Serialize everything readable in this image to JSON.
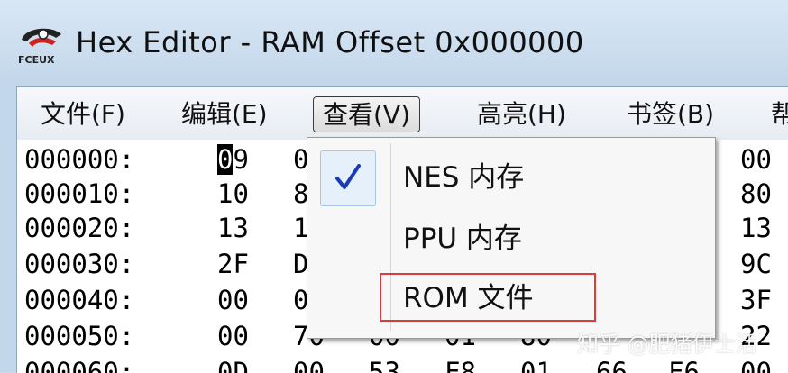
{
  "window": {
    "title": "Hex Editor - RAM Offset 0x000000",
    "logo_text": "FCEUX"
  },
  "menubar": {
    "items": [
      "文件(F)",
      "编辑(E)",
      "查看(V)",
      "高亮(H)",
      "书签(B)",
      "帮"
    ],
    "active": "查看(V)"
  },
  "hex": {
    "rows": [
      {
        "addr": "000000:",
        "b0": "09",
        "b1": "0",
        "rb": "00"
      },
      {
        "addr": "000010:",
        "b0": "10",
        "b1": "8",
        "rb": "80"
      },
      {
        "addr": "000020:",
        "b0": "13",
        "b1": "1",
        "rb": "13"
      },
      {
        "addr": "000030:",
        "b0": "2F",
        "b1": "D",
        "rb": "9C"
      },
      {
        "addr": "000040:",
        "b0": "00",
        "b1": "0",
        "rb": "3F"
      },
      {
        "addr": "000050:",
        "b0": "00",
        "b1": "70",
        "b2": "00",
        "b3": "01",
        "b4": "80",
        "rb": "22"
      },
      {
        "addr": "000060:",
        "b0": "0D",
        "b1": "00",
        "b2": "53",
        "b3": "F8",
        "b4": "01",
        "b5": "66",
        "b6": "F6",
        "rb": "00"
      }
    ],
    "cursor_char": "0",
    "cursor_rest": "9"
  },
  "view_menu": {
    "items": [
      {
        "label": "NES 内存",
        "checked": true
      },
      {
        "label": "PPU 内存",
        "checked": false
      },
      {
        "label": "ROM 文件",
        "checked": false
      }
    ],
    "highlight_color": "#e0393b",
    "check_color": "#1a3bb5"
  },
  "watermark": "知乎 @肥猪伊士活"
}
